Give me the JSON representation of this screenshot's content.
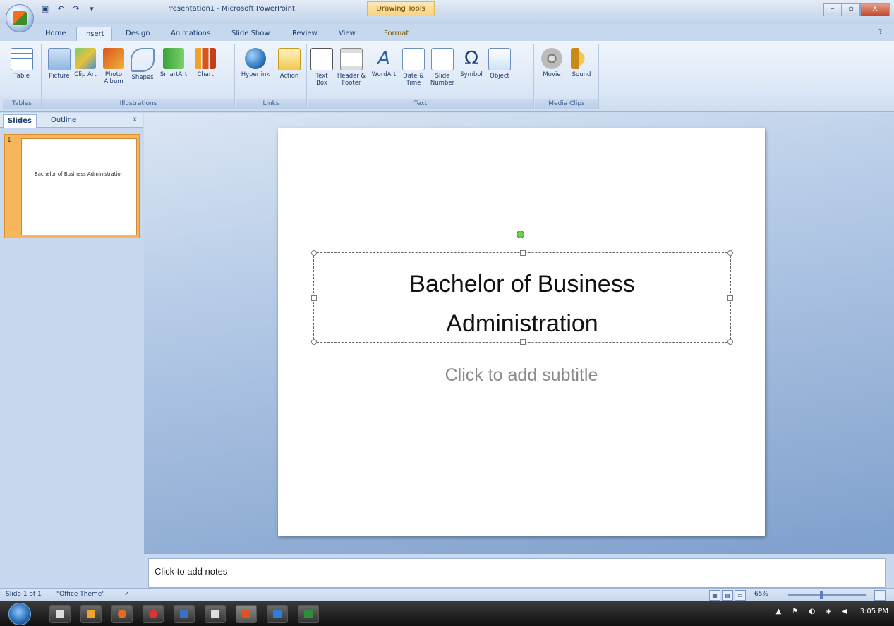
{
  "window": {
    "title": "Presentation1 - Microsoft PowerPoint",
    "contextual_tab_group": "Drawing Tools",
    "controls": [
      "–",
      "▫",
      "X"
    ]
  },
  "quick_access": [
    "save-icon",
    "undo-icon",
    "redo-icon",
    "customize-icon"
  ],
  "tabs": [
    {
      "label": "Home"
    },
    {
      "label": "Insert",
      "active": true
    },
    {
      "label": "Design"
    },
    {
      "label": "Animations"
    },
    {
      "label": "Slide Show"
    },
    {
      "label": "Review"
    },
    {
      "label": "View"
    },
    {
      "label": "Format"
    }
  ],
  "ribbon": {
    "groups": {
      "tables": "Tables",
      "illustrations": "Illustrations",
      "links": "Links",
      "text": "Text",
      "media": "Media Clips"
    },
    "buttons": {
      "table": "Table",
      "picture": "Picture",
      "clip_art": "Clip Art",
      "photo_album": "Photo Album",
      "shapes": "Shapes",
      "smartart": "SmartArt",
      "chart": "Chart",
      "hyperlink": "Hyperlink",
      "action": "Action",
      "text_box": "Text Box",
      "header_footer": "Header & Footer",
      "wordart": "WordArt",
      "date_time": "Date & Time",
      "slide_number": "Slide Number",
      "symbol": "Symbol",
      "object": "Object",
      "movie": "Movie",
      "sound": "Sound"
    }
  },
  "panel": {
    "tabs": [
      "Slides",
      "Outline"
    ],
    "close": "x",
    "thumbnail": {
      "number": "1",
      "text": "Bachelor of Business Administration"
    }
  },
  "slide": {
    "title": "Bachelor of Business\nAdministration",
    "subtitle_placeholder": "Click to add subtitle"
  },
  "notes": {
    "placeholder": "Click to add notes"
  },
  "status": {
    "slide_indicator": "Slide 1 of 1",
    "theme": "\"Office Theme\"",
    "zoom": "65%"
  },
  "taskbar": {
    "clock": "3:05 PM"
  },
  "colors": {
    "ribbon_bg": "#dbe7f6",
    "accent_selected_thumb": "#f8b65c",
    "slide_area_bg": "#7e9fcc",
    "taskbar": "#1e1e1e"
  }
}
